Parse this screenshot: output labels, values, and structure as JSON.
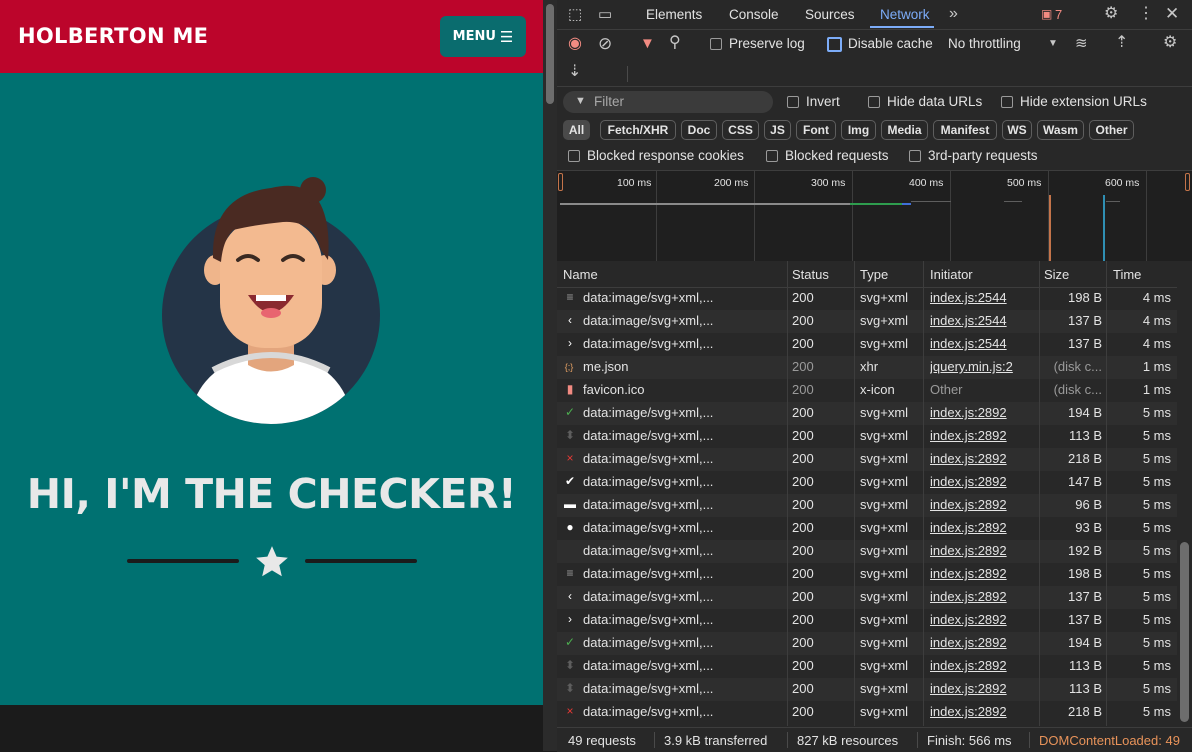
{
  "page": {
    "site_title": "HOLBERTON ME",
    "menu_label": "MENU",
    "menu_icon": "hamburger-icon",
    "heading": "HI, I'M THE CHECKER!",
    "colors": {
      "navbar": "#bc052b",
      "background": "#007171",
      "menu_button": "#0a6c6e"
    }
  },
  "devtools": {
    "tabs": [
      "Elements",
      "Console",
      "Sources",
      "Network"
    ],
    "active_tab": "Network",
    "message_count": "7",
    "toolbar": {
      "preserve_log": "Preserve log",
      "disable_cache": "Disable cache",
      "throttling": "No throttling"
    },
    "filter": {
      "placeholder": "Filter",
      "invert": "Invert",
      "hide_data_urls": "Hide data URLs",
      "hide_extension_urls": "Hide extension URLs"
    },
    "type_chips": [
      "All",
      "Fetch/XHR",
      "Doc",
      "CSS",
      "JS",
      "Font",
      "Img",
      "Media",
      "Manifest",
      "WS",
      "Wasm",
      "Other"
    ],
    "active_chip": "All",
    "checks": {
      "blocked_cookies": "Blocked response cookies",
      "blocked_requests": "Blocked requests",
      "third_party": "3rd-party requests"
    },
    "timeline_ticks": [
      "100 ms",
      "200 ms",
      "300 ms",
      "400 ms",
      "500 ms",
      "600 ms"
    ],
    "columns": [
      "Name",
      "Status",
      "Type",
      "Initiator",
      "Size",
      "Time"
    ],
    "rows": [
      {
        "icon": "≡",
        "icon_color": "#9a9a9a",
        "name": "data:image/svg+xml,...",
        "status": "200",
        "type": "svg+xml",
        "initiator": "index.js:2544",
        "size": "198 B",
        "time": "4 ms"
      },
      {
        "icon": "‹",
        "icon_color": "#ffffff",
        "name": "data:image/svg+xml,...",
        "status": "200",
        "type": "svg+xml",
        "initiator": "index.js:2544",
        "size": "137 B",
        "time": "4 ms"
      },
      {
        "icon": "›",
        "icon_color": "#ffffff",
        "name": "data:image/svg+xml,...",
        "status": "200",
        "type": "svg+xml",
        "initiator": "index.js:2544",
        "size": "137 B",
        "time": "4 ms"
      },
      {
        "icon": "{;}",
        "icon_color": "#e8a365",
        "name": "me.json",
        "status": "200",
        "type": "xhr",
        "initiator": "jquery.min.js:2",
        "size": "(disk c...",
        "time": "1 ms",
        "dim": true
      },
      {
        "icon": "▮",
        "icon_color": "#f28b82",
        "name": "favicon.ico",
        "status": "200",
        "type": "x-icon",
        "initiator": "Other",
        "size": "(disk c...",
        "time": "1 ms",
        "dim": true,
        "plain_initiator": true
      },
      {
        "icon": "✓",
        "icon_color": "#4caf50",
        "name": "data:image/svg+xml,...",
        "status": "200",
        "type": "svg+xml",
        "initiator": "index.js:2892",
        "size": "194 B",
        "time": "5 ms"
      },
      {
        "icon": "⬍",
        "icon_color": "#5e5e5e",
        "name": "data:image/svg+xml,...",
        "status": "200",
        "type": "svg+xml",
        "initiator": "index.js:2892",
        "size": "113 B",
        "time": "5 ms"
      },
      {
        "icon": "×",
        "icon_color": "#e53935",
        "name": "data:image/svg+xml,...",
        "status": "200",
        "type": "svg+xml",
        "initiator": "index.js:2892",
        "size": "218 B",
        "time": "5 ms"
      },
      {
        "icon": "✔",
        "icon_color": "#ffffff",
        "name": "data:image/svg+xml,...",
        "status": "200",
        "type": "svg+xml",
        "initiator": "index.js:2892",
        "size": "147 B",
        "time": "5 ms"
      },
      {
        "icon": "▬",
        "icon_color": "#ffffff",
        "name": "data:image/svg+xml,...",
        "status": "200",
        "type": "svg+xml",
        "initiator": "index.js:2892",
        "size": "96 B",
        "time": "5 ms"
      },
      {
        "icon": "●",
        "icon_color": "#ffffff",
        "name": "data:image/svg+xml,...",
        "status": "200",
        "type": "svg+xml",
        "initiator": "index.js:2892",
        "size": "93 B",
        "time": "5 ms"
      },
      {
        "icon": "",
        "icon_color": "#3a3a3a",
        "name": "data:image/svg+xml,...",
        "status": "200",
        "type": "svg+xml",
        "initiator": "index.js:2892",
        "size": "192 B",
        "time": "5 ms"
      },
      {
        "icon": "≡",
        "icon_color": "#9a9a9a",
        "name": "data:image/svg+xml,...",
        "status": "200",
        "type": "svg+xml",
        "initiator": "index.js:2892",
        "size": "198 B",
        "time": "5 ms"
      },
      {
        "icon": "‹",
        "icon_color": "#ffffff",
        "name": "data:image/svg+xml,...",
        "status": "200",
        "type": "svg+xml",
        "initiator": "index.js:2892",
        "size": "137 B",
        "time": "5 ms"
      },
      {
        "icon": "›",
        "icon_color": "#ffffff",
        "name": "data:image/svg+xml,...",
        "status": "200",
        "type": "svg+xml",
        "initiator": "index.js:2892",
        "size": "137 B",
        "time": "5 ms"
      },
      {
        "icon": "✓",
        "icon_color": "#4caf50",
        "name": "data:image/svg+xml,...",
        "status": "200",
        "type": "svg+xml",
        "initiator": "index.js:2892",
        "size": "194 B",
        "time": "5 ms"
      },
      {
        "icon": "⬍",
        "icon_color": "#5e5e5e",
        "name": "data:image/svg+xml,...",
        "status": "200",
        "type": "svg+xml",
        "initiator": "index.js:2892",
        "size": "113 B",
        "time": "5 ms"
      },
      {
        "icon": "⬍",
        "icon_color": "#5e5e5e",
        "name": "data:image/svg+xml,...",
        "status": "200",
        "type": "svg+xml",
        "initiator": "index.js:2892",
        "size": "113 B",
        "time": "5 ms"
      },
      {
        "icon": "×",
        "icon_color": "#e53935",
        "name": "data:image/svg+xml,...",
        "status": "200",
        "type": "svg+xml",
        "initiator": "index.js:2892",
        "size": "218 B",
        "time": "5 ms"
      }
    ],
    "status_bar": {
      "requests": "49 requests",
      "transferred": "3.9 kB transferred",
      "resources": "827 kB resources",
      "finish": "Finish: 566 ms",
      "dcl": "DOMContentLoaded: 49"
    }
  }
}
